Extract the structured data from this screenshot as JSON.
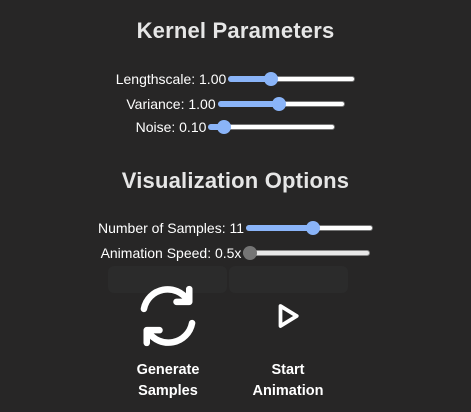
{
  "kernel": {
    "title": "Kernel Parameters",
    "params": [
      {
        "label": "Lengthscale: 1.00",
        "fraction": 0.32
      },
      {
        "label": "Variance: 1.00",
        "fraction": 0.48
      },
      {
        "label": "Noise: 0.10",
        "fraction": 0.08
      }
    ]
  },
  "visualization": {
    "title": "Visualization Options",
    "options": [
      {
        "label": "Number of Samples: 11",
        "fraction": 0.53
      },
      {
        "label": "Animation Speed: 0.5x",
        "fraction": 0.0,
        "disabled": true
      }
    ]
  },
  "actions": {
    "generate_label": "Generate Samples",
    "generate_icon": "refresh-icon",
    "start_label": "Start Animation",
    "start_icon": "play-icon"
  },
  "colors": {
    "background": "#272626",
    "accent": "#8ab4f8",
    "text": "#ffffff"
  }
}
